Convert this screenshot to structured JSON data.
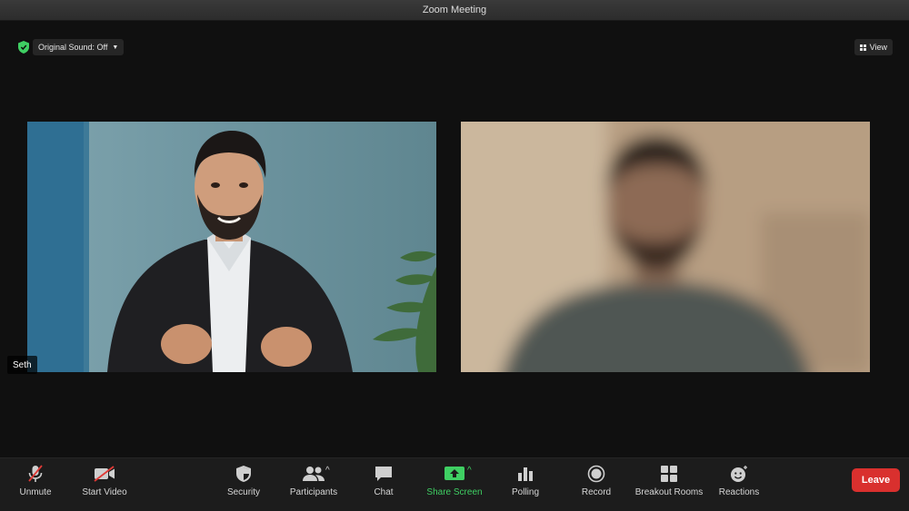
{
  "window": {
    "title": "Zoom Meeting"
  },
  "top": {
    "original_sound": "Original Sound: Off",
    "view": "View"
  },
  "participants": {
    "left_name": "Seth"
  },
  "toolbar": {
    "unmute": "Unmute",
    "start_video": "Start Video",
    "security": "Security",
    "participants": "Participants",
    "chat": "Chat",
    "share_screen": "Share Screen",
    "polling": "Polling",
    "record": "Record",
    "breakout_rooms": "Breakout Rooms",
    "reactions": "Reactions",
    "leave": "Leave"
  },
  "colors": {
    "leave": "#d9302e",
    "share_green": "#3fcf63",
    "shield_green": "#3fcf63"
  }
}
